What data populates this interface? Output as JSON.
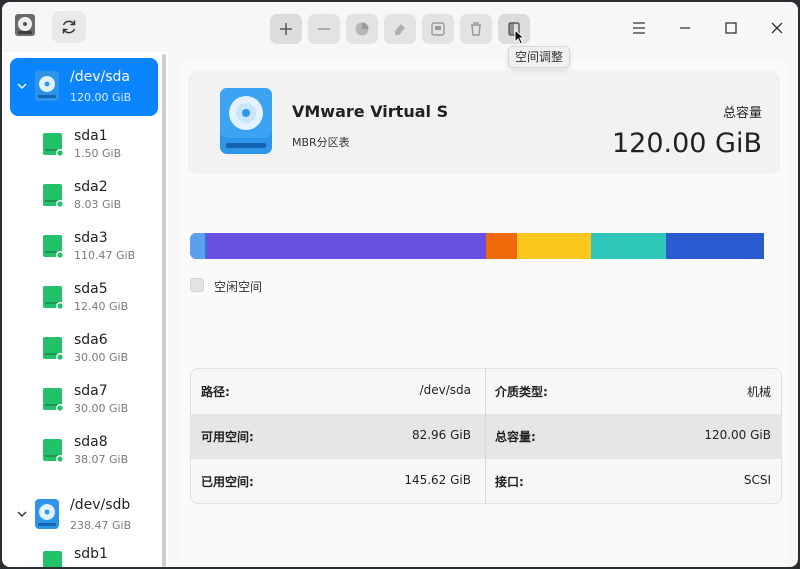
{
  "toolbar": {
    "tooltip": "空间调整",
    "icons": [
      "plus-icon",
      "minus-icon",
      "pie-icon",
      "eraser-icon",
      "format-icon",
      "delete-icon",
      "resize-icon"
    ]
  },
  "sidebar": {
    "disks": [
      {
        "name": "/dev/sda",
        "size": "120.00 GiB"
      },
      {
        "name": "/dev/sdb",
        "size": "238.47 GiB"
      }
    ],
    "partitions": [
      {
        "name": "sda1",
        "size": "1.50 GiB"
      },
      {
        "name": "sda2",
        "size": "8.03 GiB"
      },
      {
        "name": "sda3",
        "size": "110.47 GiB"
      },
      {
        "name": "sda5",
        "size": "12.40 GiB"
      },
      {
        "name": "sda6",
        "size": "30.00 GiB"
      },
      {
        "name": "sda7",
        "size": "30.00 GiB"
      },
      {
        "name": "sda8",
        "size": "38.07 GiB"
      },
      {
        "name": "sdb1",
        "size": ""
      }
    ]
  },
  "main": {
    "disk_name": "VMware Virtual S",
    "partition_table": "MBR分区表",
    "capacity_label": "总容量",
    "capacity_value": "120.00 GiB",
    "legend_label": "空闲空间",
    "usage_segments": [
      {
        "fraction": 0.025,
        "color": "#5b9ff0"
      },
      {
        "fraction": 0.003,
        "color": "#3f6ed8"
      },
      {
        "fraction": 0.472,
        "color": "#6a4fe3"
      },
      {
        "fraction": 0.052,
        "color": "#f06a0c"
      },
      {
        "fraction": 0.126,
        "color": "#fcc71c"
      },
      {
        "fraction": 0.126,
        "color": "#2fc7b9"
      },
      {
        "fraction": 0.166,
        "color": "#2c5ad1"
      }
    ],
    "info": {
      "path_label": "路径:",
      "path_value": "/dev/sda",
      "media_label": "介质类型:",
      "media_value": "机械",
      "avail_label": "可用空间:",
      "avail_value": "82.96 GiB",
      "total_label": "总容量:",
      "total_value": "120.00 GiB",
      "used_label": "已用空间:",
      "used_value": "145.62 GiB",
      "iface_label": "接口:",
      "iface_value": "SCSI"
    }
  },
  "colors": {
    "accent": "#0a84ff",
    "partition_green": "#23c26a"
  }
}
